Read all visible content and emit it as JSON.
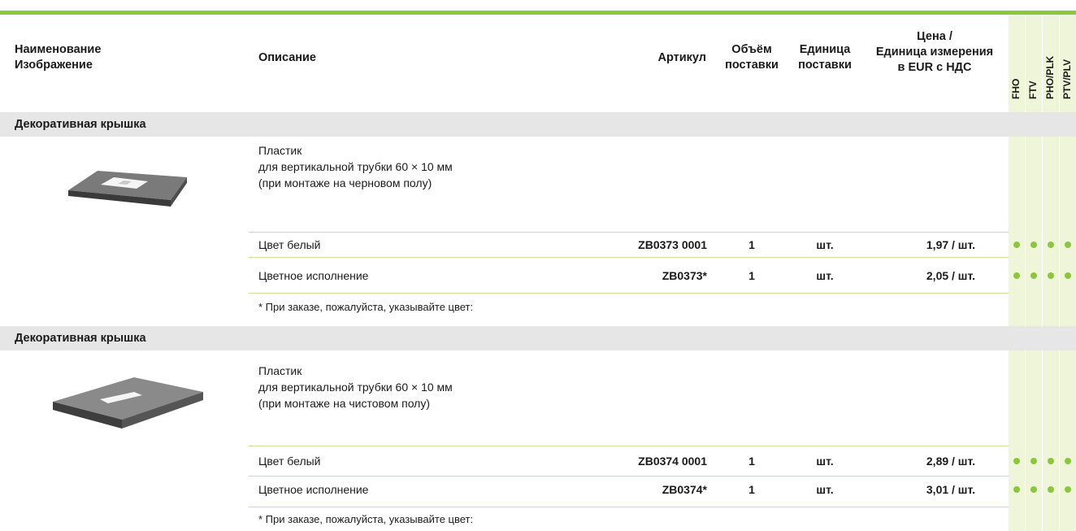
{
  "header": {
    "name_lines": [
      "Наименование",
      "Изображение"
    ],
    "description": "Описание",
    "article": "Артикул",
    "volume_lines": [
      "Объём",
      "поставки"
    ],
    "unit_lines": [
      "Единица",
      "поставки"
    ],
    "price_lines": [
      "Цена /",
      "Единица измерения",
      "в EUR с НДС"
    ],
    "compat_columns": [
      "FHO",
      "FTV",
      "PHO/PLK",
      "PTV/PLV"
    ]
  },
  "sections": [
    {
      "title": "Декоративная крышка",
      "description_lines": [
        "Пластик",
        "для вертикальной трубки 60 × 10 мм",
        "(при монтаже на черновом полу)"
      ],
      "rows": [
        {
          "desc": "Цвет белый",
          "article": "ZB0373 0001",
          "volume": "1",
          "unit": "шт.",
          "price": "1,97 / шт."
        },
        {
          "desc": "Цветное исполнение",
          "article": "ZB0373*",
          "volume": "1",
          "unit": "шт.",
          "price": "2,05 / шт."
        }
      ],
      "note": "* При заказе, пожалуйста, указывайте цвет:"
    },
    {
      "title": "Декоративная крышка",
      "description_lines": [
        "Пластик",
        "для вертикальной трубки 60 × 10 мм",
        "(при монтаже на чистовом полу)"
      ],
      "rows": [
        {
          "desc": "Цвет белый",
          "article": "ZB0374 0001",
          "volume": "1",
          "unit": "шт.",
          "price": "2,89 / шт."
        },
        {
          "desc": "Цветное исполнение",
          "article": "ZB0374*",
          "volume": "1",
          "unit": "шт.",
          "price": "3,01 / шт."
        }
      ],
      "note": "* При заказе, пожалуйста, указывайте цвет:"
    }
  ],
  "colors": {
    "accent": "#8cc63f",
    "compat_bg": "#eef5d8",
    "section_bg": "#e6e6e6"
  }
}
